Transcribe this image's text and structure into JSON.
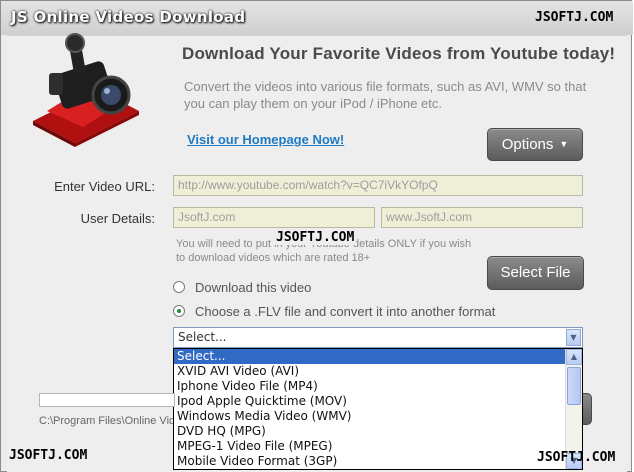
{
  "window": {
    "title": "Online Videos Download",
    "title_prefix": "JS"
  },
  "watermarks": {
    "top_right": "JSOFTJ.COM",
    "center": "JSOFTJ.COM",
    "bottom_left": "JSOFTJ.COM",
    "bottom_right": "JSOFTJ.COM"
  },
  "header": {
    "headline": "Download Your Favorite Videos from Youtube today!",
    "subtext": "Convert the videos into various file formats, such as AVI, WMV so that you can play them on your iPod / iPhone etc.",
    "homepage_link": "Visit our Homepage Now!",
    "options_label": "Options",
    "logo_icon": "video-camera-icon"
  },
  "form": {
    "url_label": "Enter Video URL:",
    "url_value": "http://www.youtube.com/watch?v=QC7iVkYOfpQ",
    "user_label": "User Details:",
    "user_value": "JsoftJ.com",
    "site_value": "www.JsoftJ.com",
    "note": "You will need to put in your Youtube details ONLY if you wish to download videos which are rated 18+",
    "select_file_label": "Select File"
  },
  "radios": {
    "download_label": "Download this video",
    "convert_label": "Choose a .FLV file and convert it into another format",
    "selected": "convert"
  },
  "format_select": {
    "current": "Select...",
    "options": [
      "Select...",
      "XVID AVI Video (AVI)",
      "Iphone Video File (MP4)",
      "Ipod Apple Quicktime (MOV)",
      "Windows Media Video (WMV)",
      "DVD HQ (MPG)",
      "MPEG-1 Video File (MPEG)",
      "Mobile Video Format (3GP)"
    ],
    "highlighted_index": 0
  },
  "status": {
    "path": "C:\\Program Files\\Online Vide",
    "progress": 0
  },
  "colors": {
    "accent_link": "#1e7bc4",
    "selection": "#316ac5",
    "button_dark": "#6b6b6b"
  }
}
